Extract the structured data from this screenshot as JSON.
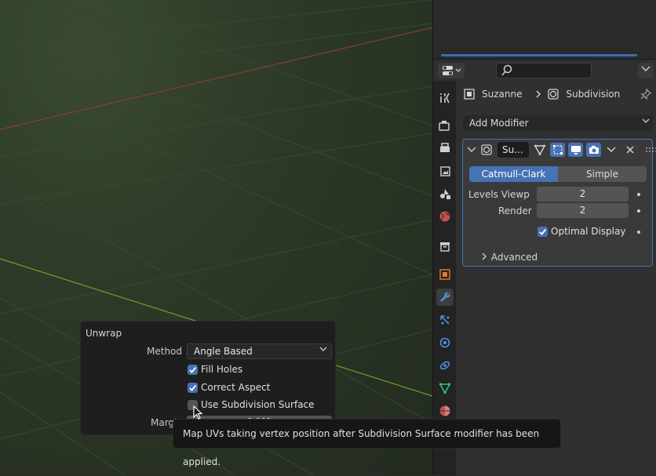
{
  "viewport": {
    "label": "3D Viewport"
  },
  "properties": {
    "breadcrumb": {
      "object": "Suzanne",
      "modifier": "Subdivision"
    },
    "add_modifier_label": "Add Modifier",
    "modifier": {
      "name": "Su...",
      "subdivision_types": [
        "Catmull-Clark",
        "Simple"
      ],
      "selected_type": "Catmull-Clark",
      "levels_viewport_label": "Levels Viewp",
      "levels_viewport_value": "2",
      "render_label": "Render",
      "render_value": "2",
      "optimal_display_label": "Optimal Display",
      "optimal_display_checked": true,
      "advanced_label": "Advanced"
    },
    "tab_icons": [
      "tool-icon",
      "render-icon",
      "output-icon",
      "view-layer-icon",
      "scene-icon",
      "world-icon",
      "collection-icon",
      "object-icon",
      "modifier-icon",
      "particles-icon",
      "physics-icon",
      "constraints-icon",
      "data-icon",
      "material-icon"
    ]
  },
  "unwrap_popup": {
    "title": "Unwrap",
    "method_label": "Method",
    "method_value": "Angle Based",
    "fill_holes_label": "Fill Holes",
    "fill_holes_checked": true,
    "correct_aspect_label": "Correct Aspect",
    "correct_aspect_checked": true,
    "use_subdivision_label": "Use Subdivision Surface",
    "use_subdivision_checked": false,
    "margin_label": "Margin",
    "margin_value": "0.001"
  },
  "tooltip": {
    "text": "Map UVs taking vertex position after Subdivision Surface modifier has been applied."
  },
  "colors": {
    "accent": "#4772b3",
    "panel": "#303030",
    "popup": "#1e1e1e"
  }
}
